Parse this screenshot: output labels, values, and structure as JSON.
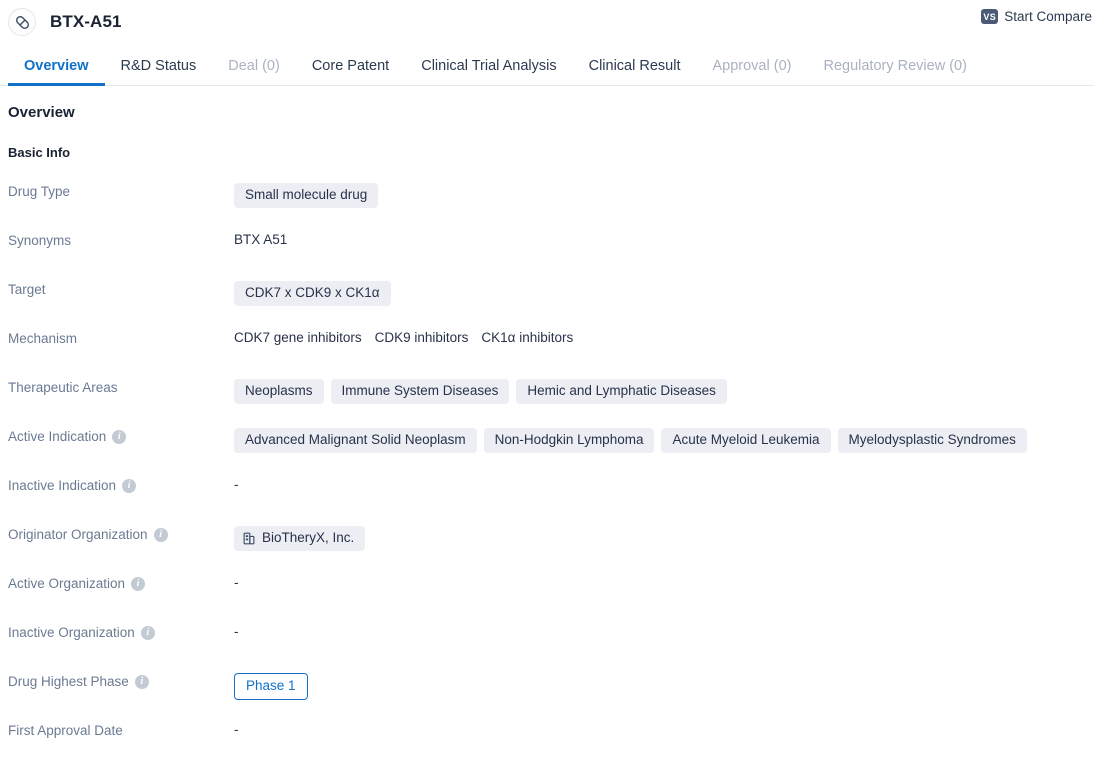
{
  "header": {
    "drug_icon": "pill-icon",
    "title": "BTX-A51",
    "compare": {
      "badge": "VS",
      "label": "Start Compare"
    }
  },
  "tabs": [
    {
      "label": "Overview",
      "state": "active"
    },
    {
      "label": "R&D Status",
      "state": "normal"
    },
    {
      "label": "Deal (0)",
      "state": "disabled"
    },
    {
      "label": "Core Patent",
      "state": "normal"
    },
    {
      "label": "Clinical Trial Analysis",
      "state": "normal"
    },
    {
      "label": "Clinical Result",
      "state": "normal"
    },
    {
      "label": "Approval (0)",
      "state": "disabled"
    },
    {
      "label": "Regulatory Review (0)",
      "state": "disabled"
    }
  ],
  "overview": {
    "section_title": "Overview",
    "subsection_title": "Basic Info",
    "rows": [
      {
        "label": "Drug Type",
        "info": false,
        "type": "chips",
        "values": [
          "Small molecule drug"
        ]
      },
      {
        "label": "Synonyms",
        "info": false,
        "type": "text",
        "values": [
          "BTX A51"
        ]
      },
      {
        "label": "Target",
        "info": false,
        "type": "chips",
        "values": [
          "CDK7 x CDK9 x CK1α"
        ]
      },
      {
        "label": "Mechanism",
        "info": false,
        "type": "textlist",
        "values": [
          "CDK7 gene inhibitors",
          "CDK9 inhibitors",
          "CK1α inhibitors"
        ]
      },
      {
        "label": "Therapeutic Areas",
        "info": false,
        "type": "chips",
        "values": [
          "Neoplasms",
          "Immune System Diseases",
          "Hemic and Lymphatic Diseases"
        ]
      },
      {
        "label": "Active Indication",
        "info": true,
        "type": "chips",
        "values": [
          "Advanced Malignant Solid Neoplasm",
          "Non-Hodgkin Lymphoma",
          "Acute Myeloid Leukemia",
          "Myelodysplastic Syndromes"
        ]
      },
      {
        "label": "Inactive Indication",
        "info": true,
        "type": "empty",
        "values": [
          "-"
        ]
      },
      {
        "label": "Originator Organization",
        "info": true,
        "type": "org",
        "values": [
          "BioTheryX, Inc."
        ]
      },
      {
        "label": "Active Organization",
        "info": true,
        "type": "empty",
        "values": [
          "-"
        ]
      },
      {
        "label": "Inactive Organization",
        "info": true,
        "type": "empty",
        "values": [
          "-"
        ]
      },
      {
        "label": "Drug Highest Phase",
        "info": true,
        "type": "phase",
        "values": [
          "Phase 1"
        ]
      },
      {
        "label": "First Approval Date",
        "info": false,
        "type": "empty",
        "values": [
          "-"
        ]
      }
    ]
  },
  "icons": {
    "info": "i",
    "org": "building-icon"
  },
  "colors": {
    "accent": "#1171c9",
    "chip_bg": "#eceef3",
    "label": "#6b7a92",
    "text": "#28324a",
    "disabled_tab": "#aab2c0"
  }
}
